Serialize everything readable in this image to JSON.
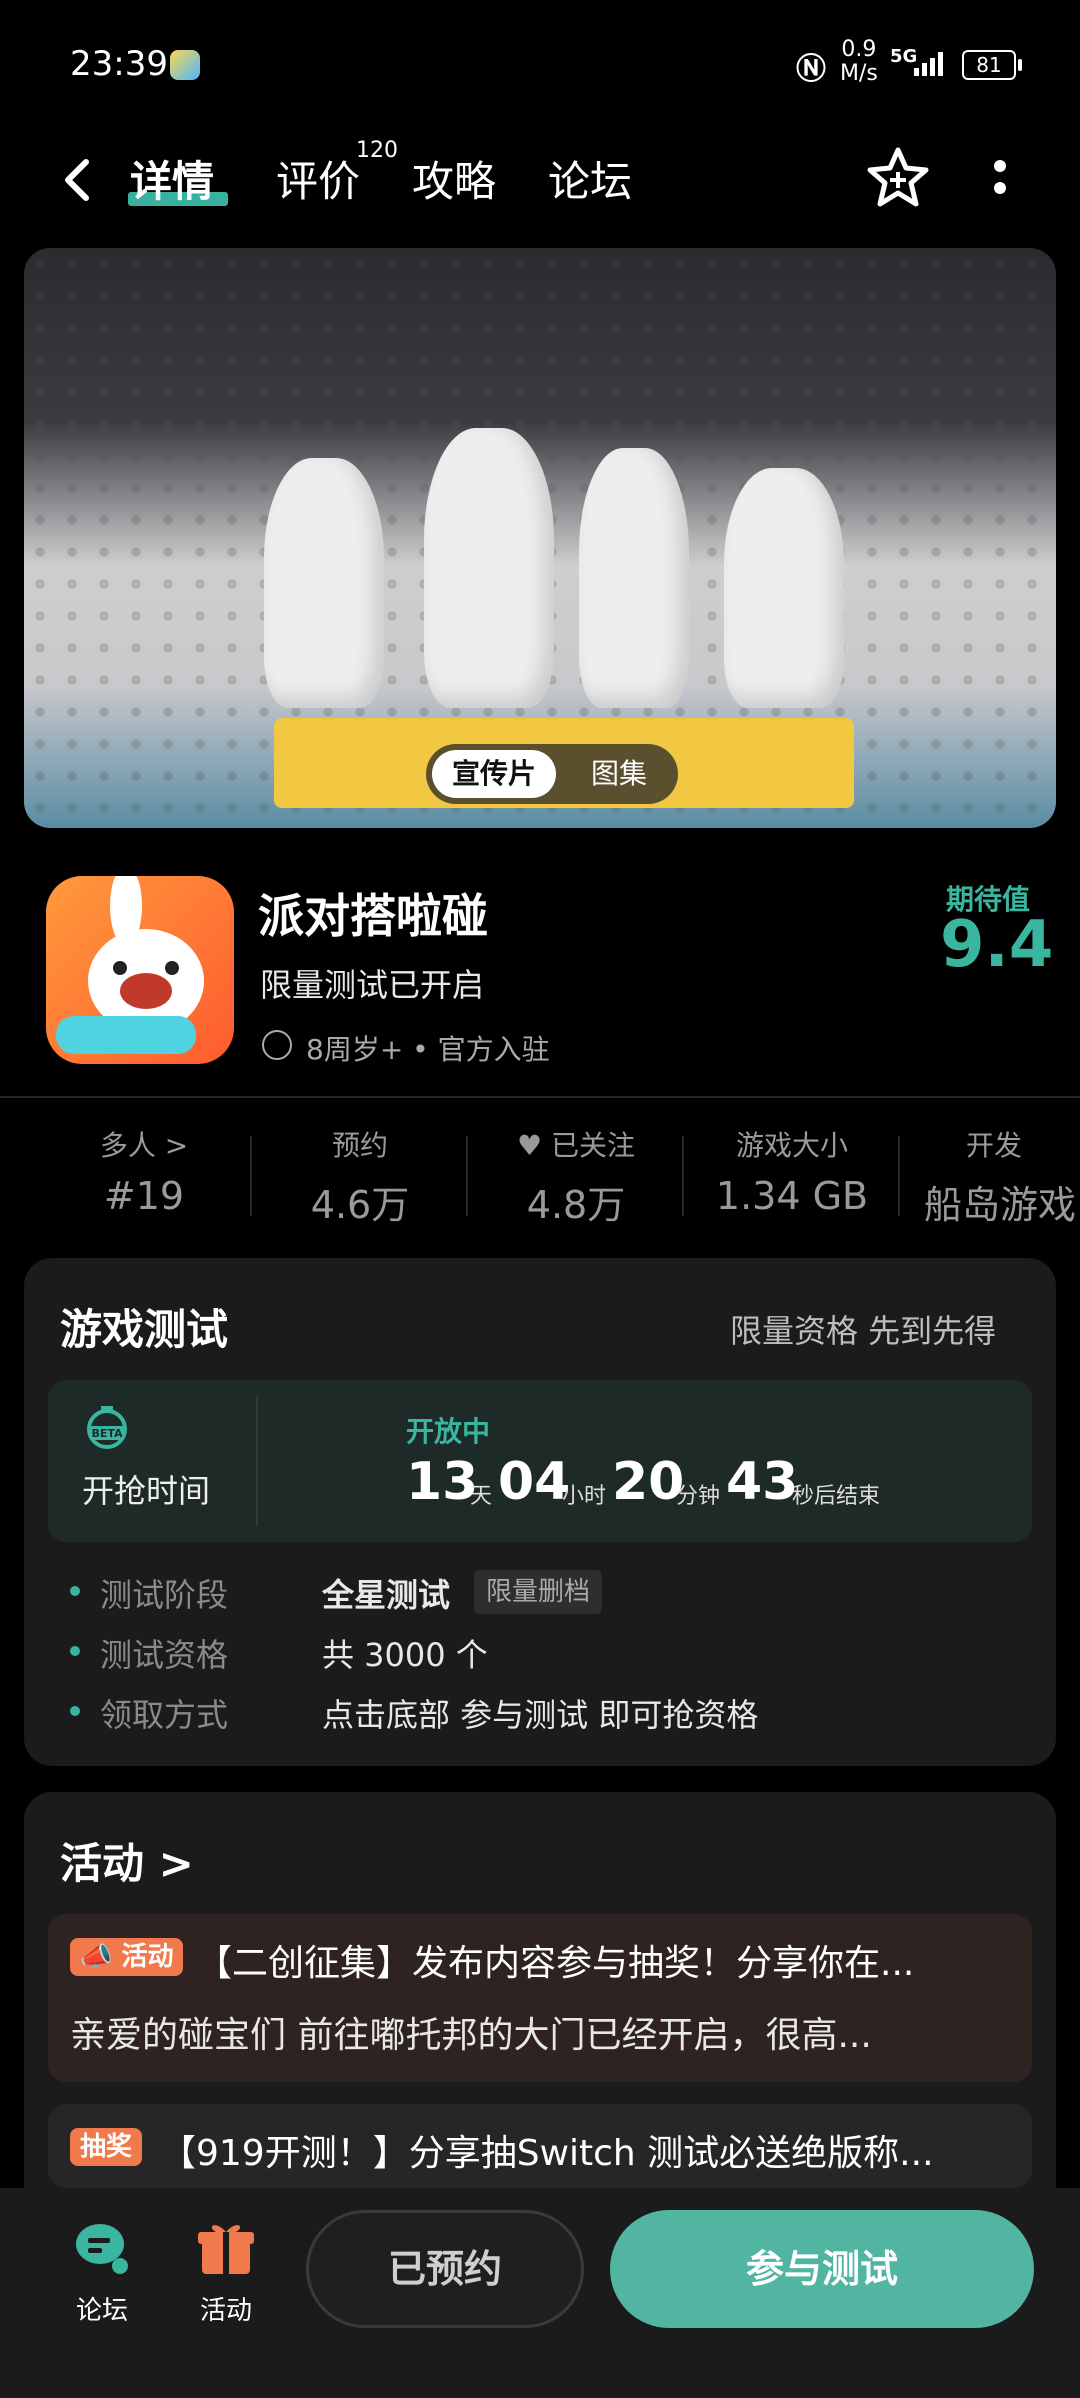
{
  "status_bar": {
    "time": "23:39",
    "net_speed_top": "0.9",
    "net_speed_bottom": "M/s",
    "signal": "5G",
    "battery": "81"
  },
  "nav": {
    "tabs": [
      {
        "label": "详情",
        "active": true
      },
      {
        "label": "评价",
        "badge": "120"
      },
      {
        "label": "攻略"
      },
      {
        "label": "论坛"
      }
    ]
  },
  "banner": {
    "segments": [
      "宣传片",
      "图集"
    ]
  },
  "game": {
    "title": "派对搭啦碰",
    "subtitle": "限量测试已开启",
    "meta": "8周岁+ • 官方入驻",
    "expect_label": "期待值",
    "expect_value": "9.4"
  },
  "stats": [
    {
      "label": "多人 >",
      "value": "#19"
    },
    {
      "label": "预约",
      "value": "4.6万"
    },
    {
      "label": "已关注",
      "value": "4.8万"
    },
    {
      "label": "游戏大小",
      "value": "1.34 GB"
    },
    {
      "label": "开发",
      "value": "船岛游戏"
    }
  ],
  "test": {
    "title": "游戏测试",
    "right_text": "限量资格 先到先得",
    "timer_label": "开抢时间",
    "status": "开放中",
    "days": "13",
    "days_unit": "天",
    "hours": "04",
    "hours_unit": "小时",
    "minutes": "20",
    "minutes_unit": "分钟",
    "seconds": "43",
    "seconds_unit": "秒后结束",
    "rows": [
      {
        "label": "测试阶段",
        "value": "全星测试",
        "tag": "限量删档"
      },
      {
        "label": "测试资格",
        "value": "共 3000 个"
      },
      {
        "label": "领取方式",
        "value": "点击底部 参与测试 即可抢资格"
      }
    ]
  },
  "activity": {
    "title": "活动 >",
    "items": [
      {
        "tag": "活动",
        "title": "【二创征集】发布内容参与抽奖！分享你在...",
        "desc": "亲爱的碰宝们 前往嘟托邦的大门已经开启，很高..."
      },
      {
        "tag": "抽奖",
        "title": "【919开测！】分享抽Switch 测试必送绝版称..."
      }
    ]
  },
  "bottom_bar": {
    "forum_label": "论坛",
    "activity_label": "活动",
    "reserved_label": "已预约",
    "join_label": "参与测试"
  },
  "colors": {
    "accent": "#3ab5a0",
    "join_button": "#52b5a2",
    "activity_tag": "#f07a4b"
  }
}
